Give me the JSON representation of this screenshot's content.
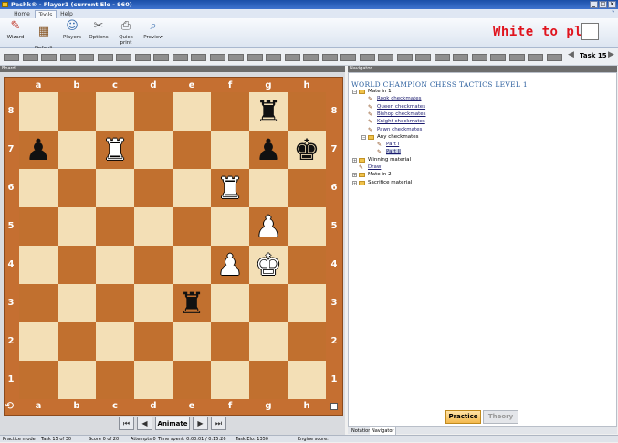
{
  "window": {
    "title": "Peshk® - Player1 (current Elo - 960)",
    "controls": [
      "_",
      "□",
      "×"
    ]
  },
  "menu": {
    "tabs": [
      "Home",
      "Tools",
      "Help"
    ],
    "active": "Tools",
    "help": "?"
  },
  "ribbon": {
    "buttons": [
      {
        "label": "Wizard",
        "icon": "wizard-hat-icon",
        "glyph": "✎"
      },
      {
        "label": "Default\nLayout",
        "icon": "checker-layout-icon",
        "glyph": "▦"
      },
      {
        "label": "Players",
        "icon": "players-icon",
        "glyph": "☺"
      },
      {
        "label": "Options",
        "icon": "tools-icon",
        "glyph": "✂"
      },
      {
        "label": "Quick print",
        "icon": "printer-icon",
        "glyph": "⎙"
      },
      {
        "label": "Preview",
        "icon": "preview-icon",
        "glyph": "⌕"
      }
    ]
  },
  "turn_indicator": {
    "text": "White to play",
    "color": "#e0141e"
  },
  "task_nav": {
    "label": "Task 15",
    "squares": 30
  },
  "board_panel": {
    "header": "Board"
  },
  "board": {
    "files": [
      "a",
      "b",
      "c",
      "d",
      "e",
      "f",
      "g",
      "h"
    ],
    "ranks": [
      "8",
      "7",
      "6",
      "5",
      "4",
      "3",
      "2",
      "1"
    ],
    "light_color": "#f3dfb6",
    "dark_color": "#c1702f",
    "pieces": [
      {
        "square": "g8",
        "piece": "rook",
        "color": "black",
        "glyph": "♜"
      },
      {
        "square": "a7",
        "piece": "pawn",
        "color": "black",
        "glyph": "♟"
      },
      {
        "square": "c7",
        "piece": "rook",
        "color": "white",
        "glyph": "♜"
      },
      {
        "square": "g7",
        "piece": "pawn",
        "color": "black",
        "glyph": "♟"
      },
      {
        "square": "h7",
        "piece": "king",
        "color": "black",
        "glyph": "♚"
      },
      {
        "square": "f6",
        "piece": "rook",
        "color": "white",
        "glyph": "♜"
      },
      {
        "square": "g5",
        "piece": "pawn",
        "color": "white",
        "glyph": "♟"
      },
      {
        "square": "f4",
        "piece": "pawn",
        "color": "white",
        "glyph": "♟"
      },
      {
        "square": "g4",
        "piece": "king",
        "color": "white",
        "glyph": "♚"
      },
      {
        "square": "e3",
        "piece": "rook",
        "color": "black",
        "glyph": "♜"
      }
    ]
  },
  "board_controls": {
    "first": "⏮",
    "prev": "◀",
    "animate": "Animate",
    "next": "▶",
    "last": "⏭"
  },
  "navigator": {
    "header": "Navigator",
    "title": "WORLD CHAMPION CHESS TACTICS LEVEL 1",
    "tree": [
      {
        "label": "Mate in 1",
        "type": "folder",
        "level": 0,
        "expanded": true
      },
      {
        "label": "Rook checkmates",
        "type": "item",
        "level": 1
      },
      {
        "label": "Queen checkmates",
        "type": "item",
        "level": 1
      },
      {
        "label": "Bishop checkmates",
        "type": "item",
        "level": 1
      },
      {
        "label": "Knight checkmates",
        "type": "item",
        "level": 1
      },
      {
        "label": "Pawn checkmates",
        "type": "item",
        "level": 1
      },
      {
        "label": "Any checkmates",
        "type": "folder",
        "level": 1,
        "expanded": true
      },
      {
        "label": "Part I",
        "type": "item",
        "level": 2
      },
      {
        "label": "Part II",
        "type": "item",
        "level": 2,
        "selected": true
      },
      {
        "label": "Winning material",
        "type": "folder",
        "level": 0
      },
      {
        "label": "Draw",
        "type": "item",
        "level": 0
      },
      {
        "label": "Mate in 2",
        "type": "folder",
        "level": 0
      },
      {
        "label": "Sacrifice material",
        "type": "folder",
        "level": 0
      }
    ]
  },
  "mode_buttons": {
    "practice": "Practice",
    "theory": "Theory"
  },
  "bottom_tabs": [
    "Notation",
    "Navigator"
  ],
  "status": {
    "mode": "Practice mode",
    "task": "Task 15 of 30",
    "score": "Score 0 of 20",
    "attempts": "Attempts 0",
    "time": "Time spent: 0:00:01 / 0:15:26",
    "task_elo": "Task Elo: 1350",
    "engine": "Engine score:"
  }
}
